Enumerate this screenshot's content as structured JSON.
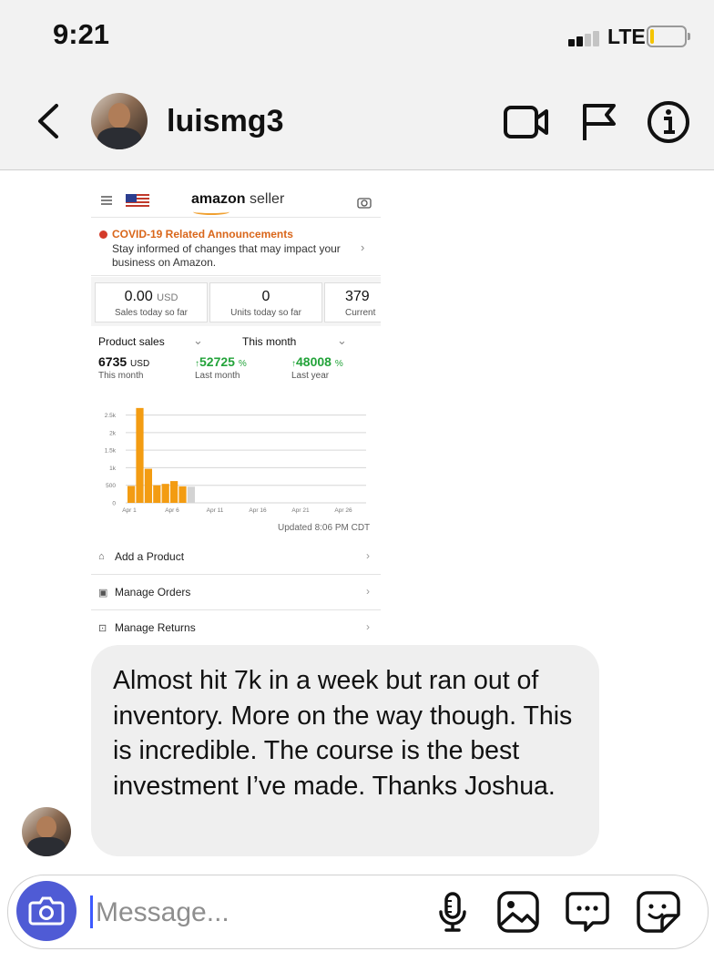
{
  "status_bar": {
    "time": "9:21",
    "network": "LTE",
    "battery_level": 0.1
  },
  "header": {
    "username": "luismg3"
  },
  "shared_image": {
    "logo_brand": "amazon",
    "logo_suffix": "seller",
    "announcement": {
      "title": "COVID-19 Related Announcements",
      "text": "Stay informed of changes that may impact your business on Amazon."
    },
    "stat_cards": [
      {
        "value": "0.00",
        "unit": "USD",
        "label": "Sales today so far"
      },
      {
        "value": "0",
        "unit": "",
        "label": "Units today so far"
      },
      {
        "value": "379",
        "unit": "",
        "label": "Current"
      }
    ],
    "selectors": {
      "metric": "Product sales",
      "period": "This month"
    },
    "summary": [
      {
        "value": "6735",
        "unit": "USD",
        "label": "This month",
        "prefix": ""
      },
      {
        "value": "52725",
        "unit": "%",
        "label": "Last month",
        "prefix": "↑"
      },
      {
        "value": "48008",
        "unit": "%",
        "label": "Last year",
        "prefix": "↑"
      }
    ],
    "updated": "Updated 8:06 PM CDT",
    "menu": [
      {
        "icon": "tag-icon",
        "label": "Add a Product"
      },
      {
        "icon": "clipboard-icon",
        "label": "Manage Orders"
      },
      {
        "icon": "box-return-icon",
        "label": "Manage Returns"
      }
    ]
  },
  "chart_data": {
    "type": "bar",
    "categories": [
      "Apr 1",
      "Apr 2",
      "Apr 3",
      "Apr 4",
      "Apr 5",
      "Apr 6",
      "Apr 7",
      "Apr 8",
      "Apr 9",
      "Apr 10",
      "Apr 11",
      "Apr 12",
      "Apr 13",
      "Apr 14",
      "Apr 15",
      "Apr 16",
      "Apr 17",
      "Apr 18",
      "Apr 19",
      "Apr 20",
      "Apr 21",
      "Apr 22",
      "Apr 23",
      "Apr 24",
      "Apr 25",
      "Apr 26",
      "Apr 27",
      "Apr 28",
      "Apr 29",
      "Apr 30"
    ],
    "values": [
      480,
      2700,
      970,
      500,
      540,
      620,
      470,
      460,
      0,
      0,
      0,
      0,
      0,
      0,
      0,
      0,
      0,
      0,
      0,
      0,
      0,
      0,
      0,
      0,
      0,
      0,
      0,
      0,
      0,
      0
    ],
    "highlight_color": "#f39c12",
    "current_day_color": "#d3d3d3",
    "current_day_index": 7,
    "yticks": [
      0,
      500,
      1000,
      1500,
      2000,
      2500
    ],
    "ytick_labels": [
      "0",
      "500",
      "1k",
      "1.5k",
      "2k",
      "2.5k"
    ],
    "xtick_labels": [
      "Apr 1",
      "Apr 6",
      "Apr 11",
      "Apr 16",
      "Apr 21",
      "Apr 26"
    ],
    "xtick_indices": [
      0,
      5,
      10,
      15,
      20,
      25
    ],
    "ylim": [
      0,
      2800
    ],
    "grid": true
  },
  "message": {
    "text": "Almost hit 7k in a week but ran out of inventory. More on the way though. This is incredible. The course is the best investment I’ve made. Thanks Joshua."
  },
  "composer": {
    "placeholder": "Message..."
  },
  "colors": {
    "accent": "#4f5bd5",
    "bubble": "#efefef",
    "orange": "#d9661a",
    "green": "#23a33a"
  }
}
